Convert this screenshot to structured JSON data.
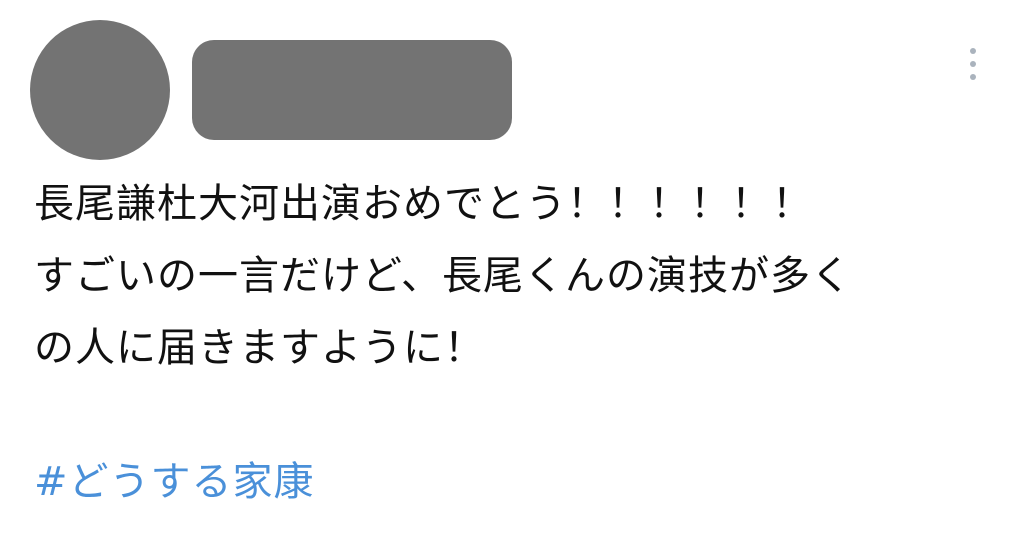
{
  "tweet": {
    "author": {
      "avatar_redacted": true,
      "name_redacted": true
    },
    "more_icon": "more-vertical-icon",
    "text_lines": [
      "長尾謙杜大河出演おめでとう！！！！！！",
      "すごいの一言だけど、長尾くんの演技が多く",
      "の人に届きますように！"
    ],
    "hashtag": "#どうする家康"
  },
  "colors": {
    "redaction": "#737373",
    "text": "#111111",
    "hashtag": "#4a90d9",
    "icon": "#aab3bd"
  }
}
